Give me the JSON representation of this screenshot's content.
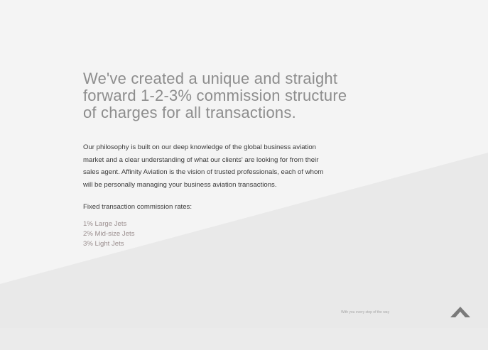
{
  "headline": {
    "lines": [
      "We've created a unique and straight",
      "forward 1-2-3% commission structure",
      "of charges for all transactions."
    ]
  },
  "body": {
    "lines": [
      "Our philosophy is built on our deep knowledge of the global business aviation",
      "market and a clear understanding of what our clients' are looking for from their",
      "sales agent. Affinity Aviation is the vision of trusted professionals, each of whom",
      "will be personally managing your business aviation transactions."
    ]
  },
  "rates": {
    "title": "Fixed transaction commission rates:",
    "items": [
      "1% Large Jets",
      "2% Mid-size Jets",
      "3% Light Jets"
    ]
  },
  "footer": {
    "tagline": "With you every step of the way",
    "scroll_icon": "chevron-up-icon"
  },
  "colors": {
    "background": "#f4f4f4",
    "wedge": "#e9e9e9",
    "headline": "#8d8d8d",
    "body_text": "#3a3a3a",
    "rate_text": "#9b8f8f",
    "icon": "#7a7a7a"
  }
}
